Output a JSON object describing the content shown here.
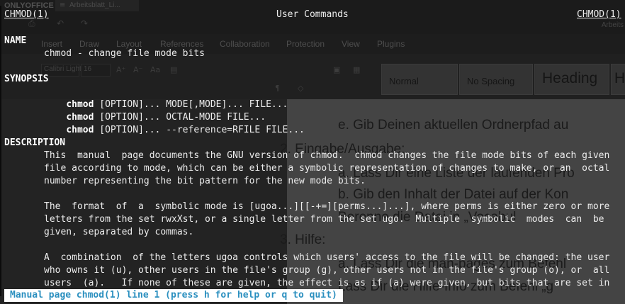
{
  "office": {
    "logo": "ONLYOFFICE",
    "doc_tab": {
      "icon": "≡",
      "label": "Arbeitsblatt_Li..."
    },
    "user_label": "Arbeits",
    "menu_items": [
      "Insert",
      "Draw",
      "Layout",
      "References",
      "Collaboration",
      "Protection",
      "View",
      "Plugins"
    ],
    "font_name": "Calibri Light",
    "font_size": "16",
    "styles": [
      "Normal",
      "No Spacing",
      "Heading",
      "H"
    ],
    "document_lines": [
      "e.   Gib Deinen aktuellen Ordnerpfad au",
      "2.   Eingabe/Ausgabe:",
      "a.   Lass Dir eine Liste der laufenden Pro",
      "b.   Gib den Inhalt der Datei auf der Kon",
      "      Berenne die Datei in „Vocabul",
      "3.   Hilfe:",
      "a.   Lass Dir die man-pages zum Befehl",
      "      Lass Dir die Hilfe-Info zum Befehl „g"
    ]
  },
  "terminal": {
    "header_left": "CHMOD(1)",
    "header_center": "User Commands",
    "header_right": "CHMOD(1)",
    "name_heading": "NAME",
    "name_text": "chmod - change file mode bits",
    "synopsis_heading": "SYNOPSIS",
    "synopsis": [
      {
        "cmd": "chmod",
        "rest": " [OPTION]... MODE[,MODE]... FILE..."
      },
      {
        "cmd": "chmod",
        "rest": " [OPTION]... OCTAL-MODE FILE..."
      },
      {
        "cmd": "chmod",
        "rest": " [OPTION]... --reference=RFILE FILE..."
      }
    ],
    "description_heading": "DESCRIPTION",
    "desc1": [
      "This  manual  page documents the GNU version of chmod.  chmod changes the file mode bits of each given",
      "file according to mode, which can be either a symbolic representation of changes to make, or an  octal",
      "number representing the bit pattern for the new mode bits."
    ],
    "desc2": [
      "The  format  of  a  symbolic mode is [ugoa...][[-+=][perms...]...], where perms is either zero or more",
      "letters from the set rwxXst, or a single letter from the set ugo.  Multiple  symbolic  modes  can  be",
      "given, separated by commas."
    ],
    "desc3": [
      "A  combination  of the letters ugoa controls which users' access to the file will be changed: the user",
      "who owns it (u), other users in the file's group (g), other users not in the file's group (o), or  all",
      "users  (a).   If none of these are given, the effect is as if (a) were given, but bits that are set in"
    ],
    "status": "Manual page chmod(1) line 1 (press h for help or q to quit)"
  }
}
